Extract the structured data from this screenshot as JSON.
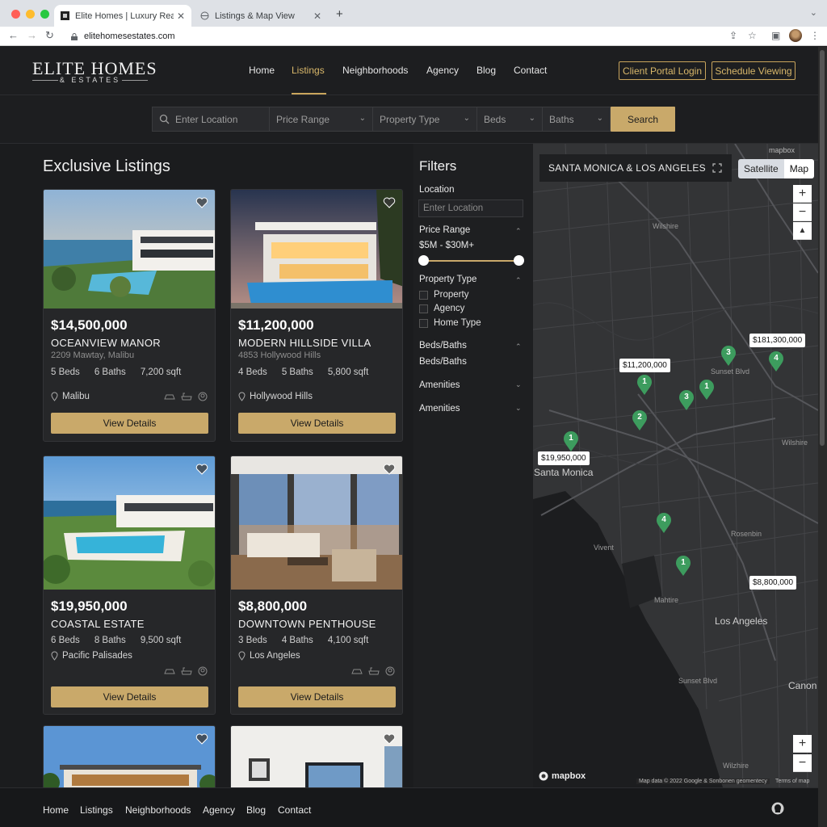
{
  "browser": {
    "tabs": [
      {
        "title": "Elite Homes | Luxury Real Est"
      },
      {
        "title": "Listings & Map View"
      }
    ],
    "url": "elitehomesestates.com"
  },
  "header": {
    "logo_main": "ELITE HOMES",
    "logo_sub": "& ESTATES",
    "nav": [
      "Home",
      "Listings",
      "Neighborhoods",
      "Agency",
      "Blog",
      "Contact"
    ],
    "active_nav": "Listings",
    "client_login": "Client Portal Login",
    "schedule": "Schedule Viewing"
  },
  "search": {
    "location_placeholder": "Enter Location",
    "price": "Price Range",
    "type": "Property Type",
    "beds": "Beds",
    "baths": "Baths",
    "button": "Search"
  },
  "listings_title": "Exclusive Listings",
  "listings": [
    {
      "price": "$14,500,000",
      "name": "OCEANVIEW MANOR",
      "address": "2209 Mawtay, Malibu",
      "beds": "5 Beds",
      "baths": "6 Baths",
      "sqft": "7,200 sqft",
      "location": "Malibu",
      "button": "View Details"
    },
    {
      "price": "$11,200,000",
      "name": "MODERN HILLSIDE VILLA",
      "address": "4853 Hollywood Hills",
      "beds": "4 Beds",
      "baths": "5 Baths",
      "sqft": "5,800 sqft",
      "location": "Hollywood Hills",
      "button": "View Details"
    },
    {
      "price": "$19,950,000",
      "name": "COASTAL ESTATE",
      "address": "",
      "beds": "6 Beds",
      "baths": "8 Baths",
      "sqft": "9,500 sqft",
      "location": "Pacific Palisades",
      "button": "View Details"
    },
    {
      "price": "$8,800,000",
      "name": "DOWNTOWN PENTHOUSE",
      "address": "",
      "beds": "3 Beds",
      "baths": "4 Baths",
      "sqft": "4,100 sqft",
      "location": "Los Angeles",
      "button": "View Details"
    }
  ],
  "filters": {
    "title": "Filters",
    "location_label": "Location",
    "location_placeholder": "Enter Location",
    "price_label": "Price Range",
    "price_value": "$5M - $30M+",
    "price_slider": {
      "low": 0.0,
      "high": 1.0
    },
    "type_label": "Property Type",
    "type_options": [
      "Property",
      "Agency",
      "Home Type"
    ],
    "bedsbaths_label": "Beds/Baths",
    "bedsbaths_sub": "Beds/Baths",
    "amenities_1": "Amenities",
    "amenities_2": "Amenities"
  },
  "map": {
    "title": "SANTA MONICA & LOS ANGELES",
    "satellite": "Satellite",
    "map": "Map",
    "zoom_in": "+",
    "zoom_out": "−",
    "compass": "▲",
    "brand_top": "mapbox",
    "brand_bottom": "mapbox",
    "attribution": "Map data © 2022 Google & Sonbonen geomentecy",
    "terms": "Terms of map",
    "price_tags": [
      "$11,200,000",
      "$19,950,000",
      "$181,300,000",
      "$8,800,000"
    ],
    "markers": [
      "3",
      "4",
      "1",
      "3",
      "1",
      "2",
      "1",
      "4",
      "1"
    ],
    "place_labels": {
      "santa_monica": "Santa Monica",
      "los_angeles": "Los Angeles",
      "canon": "Canon",
      "wilshire": "Wilshire",
      "sunset_blvd": "Sunset Blvd",
      "sunset_blvd2": "Sunset Blvd",
      "wilshire2": "Wilshire",
      "wilzhire": "Wilzhire",
      "rosenbin": "Rosenbin",
      "mahtire": "Mahtire",
      "vivent": "Vivent"
    }
  },
  "footer": {
    "links": [
      "Home",
      "Listings",
      "Neighborhoods",
      "Agency",
      "Blog",
      "Contact"
    ]
  },
  "colors": {
    "gold": "#c9a96a",
    "bg": "#1b1c1e",
    "marker": "#3d9c5e"
  }
}
